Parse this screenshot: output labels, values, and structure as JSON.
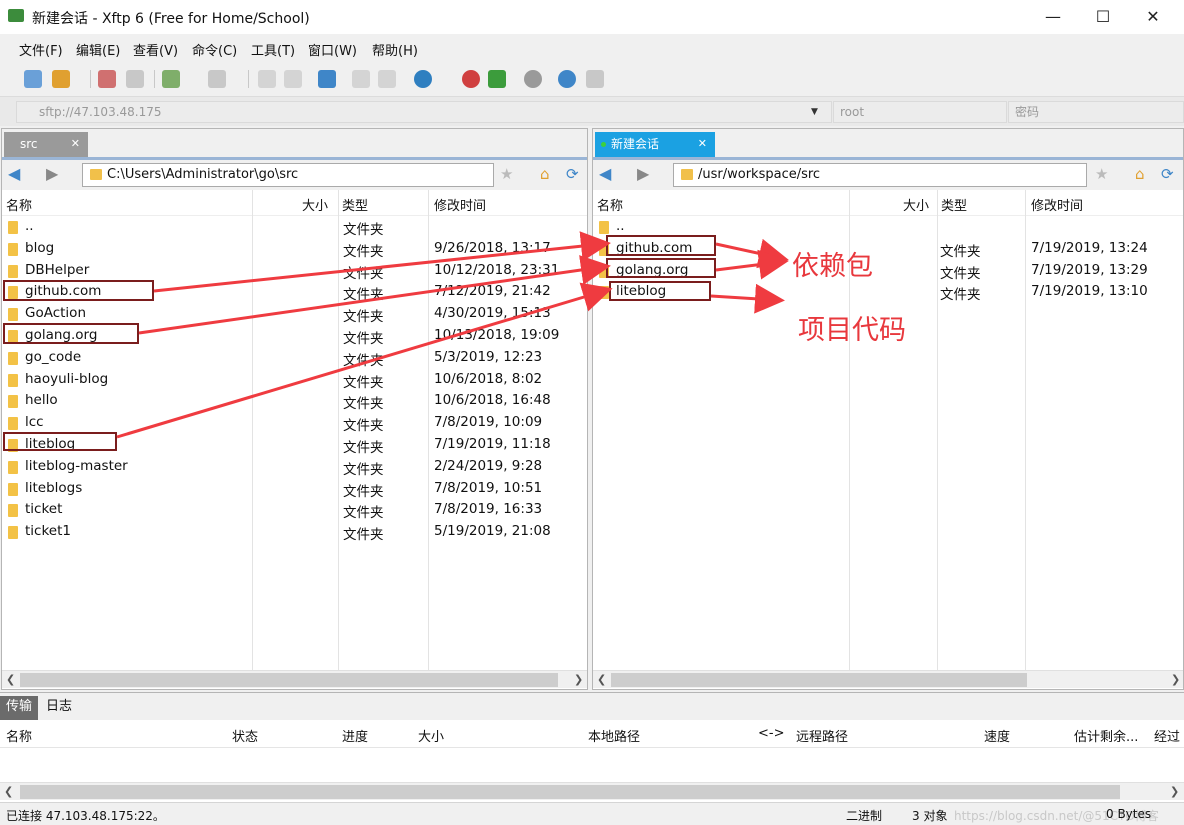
{
  "window": {
    "title": "新建会话 - Xftp 6 (Free for Home/School)"
  },
  "menu": [
    "文件(F)",
    "编辑(E)",
    "查看(V)",
    "命令(C)",
    "工具(T)",
    "窗口(W)",
    "帮助(H)"
  ],
  "address": {
    "host": "sftp://47.103.48.175",
    "user": "root",
    "password_placeholder": "密码"
  },
  "left": {
    "tab": "src",
    "path": "C:\\Users\\Administrator\\go\\src",
    "columns": {
      "name": "名称",
      "size": "大小",
      "type": "类型",
      "modified": "修改时间"
    },
    "rows": [
      {
        "name": "..",
        "type": "文件夹",
        "modified": ""
      },
      {
        "name": "blog",
        "type": "文件夹",
        "modified": "9/26/2018, 13:17"
      },
      {
        "name": "DBHelper",
        "type": "文件夹",
        "modified": "10/12/2018, 23:31"
      },
      {
        "name": "github.com",
        "type": "文件夹",
        "modified": "7/12/2019, 21:42"
      },
      {
        "name": "GoAction",
        "type": "文件夹",
        "modified": "4/30/2019, 15:13"
      },
      {
        "name": "golang.org",
        "type": "文件夹",
        "modified": "10/13/2018, 19:09"
      },
      {
        "name": "go_code",
        "type": "文件夹",
        "modified": "5/3/2019, 12:23"
      },
      {
        "name": "haoyuli-blog",
        "type": "文件夹",
        "modified": "10/6/2018, 8:02"
      },
      {
        "name": "hello",
        "type": "文件夹",
        "modified": "10/6/2018, 16:48"
      },
      {
        "name": "lcc",
        "type": "文件夹",
        "modified": "7/8/2019, 10:09"
      },
      {
        "name": "liteblog",
        "type": "文件夹",
        "modified": "7/19/2019, 11:18"
      },
      {
        "name": "liteblog-master",
        "type": "文件夹",
        "modified": "2/24/2019, 9:28"
      },
      {
        "name": "liteblogs",
        "type": "文件夹",
        "modified": "7/8/2019, 10:51"
      },
      {
        "name": "ticket",
        "type": "文件夹",
        "modified": "7/8/2019, 16:33"
      },
      {
        "name": "ticket1",
        "type": "文件夹",
        "modified": "5/19/2019, 21:08"
      }
    ]
  },
  "right": {
    "tab": "新建会话",
    "path": "/usr/workspace/src",
    "columns": {
      "name": "名称",
      "size": "大小",
      "type": "类型",
      "modified": "修改时间"
    },
    "rows": [
      {
        "name": "..",
        "type": "",
        "modified": ""
      },
      {
        "name": "github.com",
        "type": "文件夹",
        "modified": "7/19/2019, 13:24"
      },
      {
        "name": "golang.org",
        "type": "文件夹",
        "modified": "7/19/2019, 13:29"
      },
      {
        "name": "liteblog",
        "type": "文件夹",
        "modified": "7/19/2019, 13:10"
      }
    ]
  },
  "annotations": {
    "deps": "依赖包",
    "project": "项目代码"
  },
  "transfer": {
    "tabs": [
      "传输",
      "日志"
    ],
    "columns": [
      "名称",
      "状态",
      "进度",
      "大小",
      "本地路径",
      "<->",
      "远程路径",
      "速度",
      "估计剩余...",
      "经过"
    ]
  },
  "status": {
    "left": "已连接 47.103.48.175:22。",
    "mode": "二进制",
    "objects": "3 对象",
    "size": "0 Bytes",
    "watermark": "https://blog.csdn.net/@51CTO博客"
  },
  "colors": {
    "accent": "#1ba1e2",
    "annot_red": "#e8383d",
    "box": "#7a1d1d",
    "folder": "#f3c246"
  }
}
